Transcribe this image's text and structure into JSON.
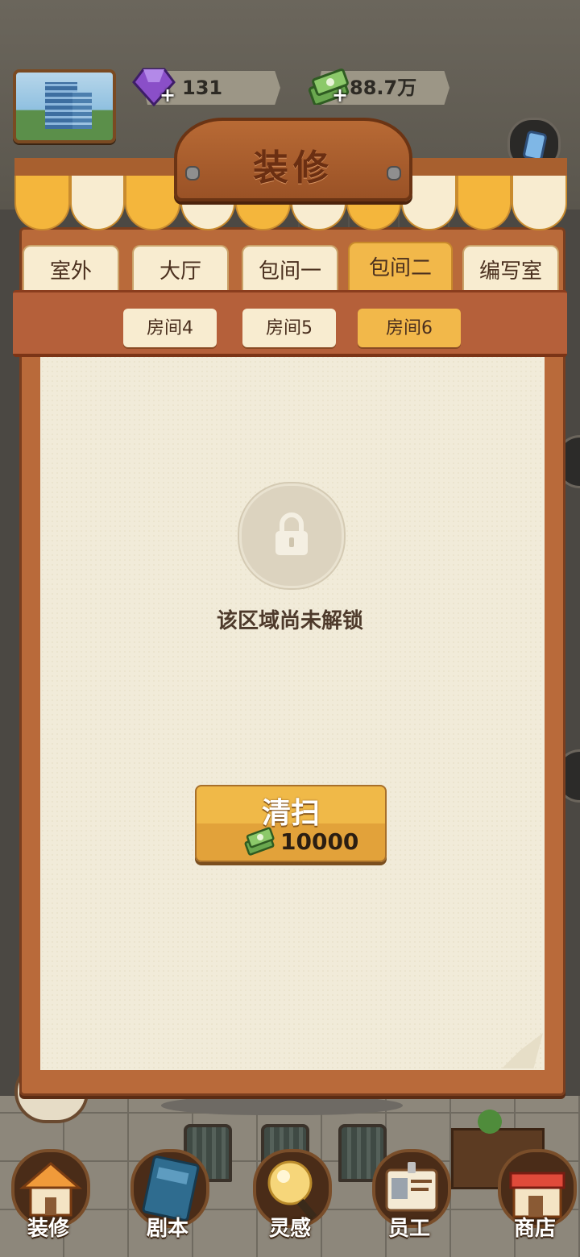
{
  "currency": {
    "gems": "131",
    "cash": "88.7万"
  },
  "panel": {
    "title": "装修"
  },
  "tabs": [
    {
      "label": "室外",
      "active": false
    },
    {
      "label": "大厅",
      "active": false
    },
    {
      "label": "包间一",
      "active": false
    },
    {
      "label": "包间二",
      "active": true
    },
    {
      "label": "编写室",
      "active": false
    }
  ],
  "subtabs": [
    {
      "label": "房间4",
      "active": false
    },
    {
      "label": "房间5",
      "active": false
    },
    {
      "label": "房间6",
      "active": true
    }
  ],
  "locked": {
    "message": "该区域尚未解锁"
  },
  "clean_button": {
    "label": "清扫",
    "cost": "10000"
  },
  "nav": [
    {
      "label": "装修",
      "icon": "house-icon"
    },
    {
      "label": "剧本",
      "icon": "script-book-icon"
    },
    {
      "label": "灵感",
      "icon": "lightbulb-icon"
    },
    {
      "label": "员工",
      "icon": "staff-badge-icon"
    },
    {
      "label": "商店",
      "icon": "shop-icon"
    }
  ],
  "colors": {
    "accent_yellow": "#f2b84a",
    "tab_cream": "#f8ecd0",
    "wood_brown": "#b5603a",
    "paper": "#f1ebd9"
  }
}
